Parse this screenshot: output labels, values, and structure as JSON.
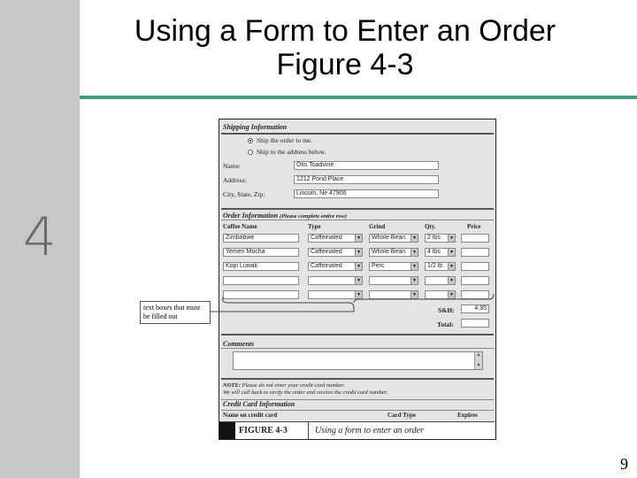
{
  "slide": {
    "title_line1": "Using a Form to Enter an Order",
    "title_line2": "Figure 4-3",
    "chapter_number": "4",
    "page_number": "9",
    "rule_color": "#3c9e8a"
  },
  "callout": {
    "text": "text boxes that must be filled out"
  },
  "form": {
    "shipping": {
      "heading": "Shipping Information",
      "radio_me": "Ship the order to me.",
      "radio_other": "Ship to the address below.",
      "name_label": "Name:",
      "name_value": "Otis Toadvine",
      "address_label": "Address:",
      "address_value": "1212 Pond Place",
      "city_label": "City, State, Zip:",
      "city_value": "Lincoln, Ne 47906"
    },
    "order": {
      "heading": "Order Information",
      "heading_note": "(Please complete entire row)",
      "columns": [
        "Coffee Name",
        "Type",
        "Grind",
        "Qty.",
        "Price"
      ],
      "rows": [
        {
          "coffee": "Zimbabwe",
          "type": "Caffeinated",
          "grind": "Whole Bean",
          "qty": "2 lbs",
          "price": ""
        },
        {
          "coffee": "Yemen Mocha",
          "type": "Caffeinated",
          "grind": "Whole Bean",
          "qty": "4 lbs",
          "price": ""
        },
        {
          "coffee": "Kopi Luwak",
          "type": "Caffeinated",
          "grind": "Perc",
          "qty": "1/2 lb",
          "price": ""
        },
        {
          "coffee": "",
          "type": "",
          "grind": "",
          "qty": "",
          "price": ""
        },
        {
          "coffee": "",
          "type": "",
          "grind": "",
          "qty": "",
          "price": ""
        }
      ],
      "sh_label": "S&H:",
      "sh_value": "4.95",
      "total_label": "Total:",
      "total_value": ""
    },
    "comments": {
      "heading": "Comments"
    },
    "note": {
      "prefix": "NOTE:",
      "line1": "Please do not enter your credit card number.",
      "line2": "We will call back to verify the order and receive the credit card number."
    },
    "credit": {
      "heading": "Credit Card Information",
      "col_name": "Name on credit card",
      "col_type": "Card Type",
      "col_expires": "Expires"
    },
    "caption": {
      "label": "FIGURE 4-3",
      "text": "Using a form to enter an order"
    }
  }
}
